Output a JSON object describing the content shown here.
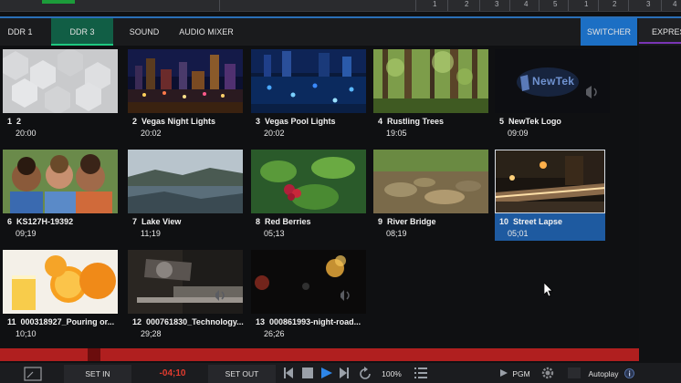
{
  "timeline": {
    "numbers": [
      "1",
      "2",
      "3",
      "4",
      "5",
      "1",
      "2",
      "3",
      "4"
    ]
  },
  "tabs": {
    "ddr1": "DDR 1",
    "ddr3": "DDR 3",
    "sound": "SOUND",
    "audio_mixer": "AUDIO MIXER",
    "switcher": "SWITCHER",
    "express": "EXPRESS"
  },
  "clips": [
    {
      "num": "1",
      "name": "2",
      "duration": "20:00"
    },
    {
      "num": "2",
      "name": "Vegas Night Lights",
      "duration": "20:02"
    },
    {
      "num": "3",
      "name": "Vegas Pool Lights",
      "duration": "20:02"
    },
    {
      "num": "4",
      "name": "Rustling Trees",
      "duration": "19:05"
    },
    {
      "num": "5",
      "name": "NewTek Logo",
      "duration": "09:09"
    },
    {
      "num": "6",
      "name": "KS127H-19392",
      "duration": "09;19"
    },
    {
      "num": "7",
      "name": "Lake View",
      "duration": "11;19"
    },
    {
      "num": "8",
      "name": "Red Berries",
      "duration": "05;13"
    },
    {
      "num": "9",
      "name": "River Bridge",
      "duration": "08;19"
    },
    {
      "num": "10",
      "name": "Street Lapse",
      "duration": "05;01"
    },
    {
      "num": "11",
      "name": "000318927_Pouring or...",
      "duration": "10;10"
    },
    {
      "num": "12",
      "name": "000761830_Technology...",
      "duration": "29;28"
    },
    {
      "num": "13",
      "name": "000861993-night-road...",
      "duration": "26;26"
    }
  ],
  "thumb_text": {
    "newtek_logo": "NewTek"
  },
  "controls": {
    "set_in": "SET IN",
    "time": "-04;10",
    "set_out": "SET OUT",
    "speed": "100%",
    "pgm": "PGM",
    "autoplay": "Autoplay"
  },
  "colors": {
    "selected": "#1e5aa0",
    "ddr3_tab": "#115e45",
    "switcher_tab": "#1c6fc4",
    "timeline_red": "#b01f1f",
    "time_readout": "#e23b2e"
  }
}
